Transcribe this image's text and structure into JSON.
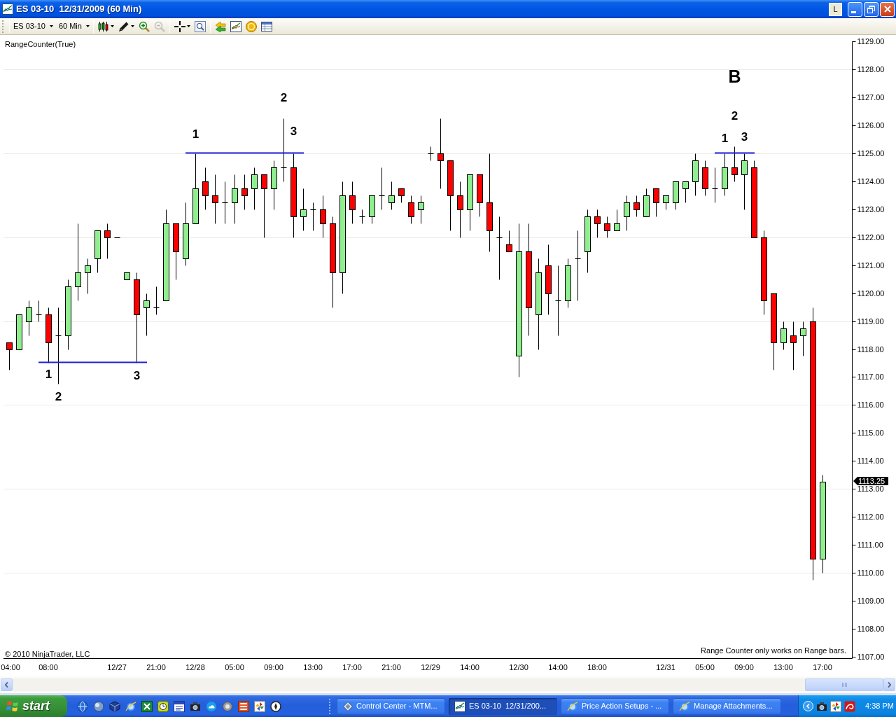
{
  "window": {
    "title": "ES 03-10  12/31/2009 (60 Min)",
    "corner_button": "L"
  },
  "toolbar": {
    "instrument": "ES 03-10",
    "interval": "60 Min",
    "tool_groups": [
      [
        {
          "kind": "bar_style",
          "disabled": false
        },
        {
          "kind": "draw",
          "disabled": false
        },
        {
          "kind": "zoom_in",
          "disabled": false
        },
        {
          "kind": "zoom_out",
          "disabled": true
        }
      ],
      [
        {
          "kind": "crosshair",
          "disabled": false
        },
        {
          "kind": "zoom_box",
          "disabled": false
        }
      ],
      [
        {
          "kind": "data_series",
          "disabled": false
        },
        {
          "kind": "indicators",
          "disabled": false
        },
        {
          "kind": "strategies",
          "disabled": false
        },
        {
          "kind": "properties",
          "disabled": false
        }
      ]
    ]
  },
  "chart": {
    "indicator_label": "RangeCounter(True)",
    "setup_labels": [
      {
        "kind": "letter",
        "text": "B"
      },
      {
        "kind": "count",
        "text": "2"
      },
      {
        "kind": "count",
        "text": "2"
      },
      {
        "kind": "count",
        "text": "1"
      },
      {
        "kind": "count",
        "text": "3"
      },
      {
        "kind": "count",
        "text": "1"
      },
      {
        "kind": "count",
        "text": "3"
      },
      {
        "kind": "count",
        "text": "1"
      },
      {
        "kind": "count",
        "text": "3"
      },
      {
        "kind": "count",
        "text": "2"
      }
    ],
    "last_price": "1113.25",
    "chart_data": {
      "type": "candlestick",
      "ylim": [
        1107,
        1129
      ],
      "grid": true,
      "categories": [
        "04:00",
        null,
        null,
        null,
        "08:00",
        null,
        null,
        null,
        null,
        null,
        null,
        "12/27",
        null,
        null,
        null,
        "21:00",
        null,
        null,
        null,
        "12/28",
        null,
        null,
        null,
        "05:00",
        null,
        null,
        null,
        "09:00",
        null,
        null,
        null,
        "13:00",
        null,
        null,
        null,
        "17:00",
        null,
        null,
        null,
        "21:00",
        null,
        null,
        null,
        "12/29",
        null,
        null,
        null,
        "14:00",
        null,
        null,
        null,
        null,
        "12/30",
        null,
        null,
        null,
        "14:00",
        null,
        null,
        null,
        "18:00",
        null,
        null,
        null,
        null,
        null,
        null,
        "12/31",
        null,
        null,
        null,
        "05:00",
        null,
        null,
        null,
        "09:00",
        null,
        null,
        null,
        "13:00",
        null,
        null,
        null,
        "17:00"
      ],
      "ohlc": [
        [
          1118.25,
          1118.25,
          1117.25,
          1118.0
        ],
        [
          1118.0,
          1119.25,
          1118.0,
          1119.25
        ],
        [
          1119.0,
          1119.75,
          1118.5,
          1119.5
        ],
        [
          1119.25,
          1119.75,
          1119.0,
          1119.25
        ],
        [
          1119.25,
          1119.5,
          1117.5,
          1118.25
        ],
        [
          1118.5,
          1119.5,
          1116.75,
          1118.5
        ],
        [
          1118.5,
          1120.5,
          1118.0,
          1120.25
        ],
        [
          1120.25,
          1122.5,
          1119.75,
          1120.75
        ],
        [
          1120.75,
          1121.25,
          1120.0,
          1121.0
        ],
        [
          1121.25,
          1122.25,
          1120.75,
          1122.25
        ],
        [
          1122.25,
          1122.5,
          1121.25,
          1122.0
        ],
        [
          1122.0,
          1122.0,
          1122.0,
          1122.0
        ],
        [
          1120.5,
          1120.75,
          1120.5,
          1120.75
        ],
        [
          1120.5,
          1120.75,
          1117.5,
          1119.25
        ],
        [
          1119.5,
          1120.0,
          1118.5,
          1119.75
        ],
        [
          1119.5,
          1120.25,
          1119.25,
          1119.5
        ],
        [
          1119.75,
          1123.0,
          1119.75,
          1122.5
        ],
        [
          1122.5,
          1122.5,
          1120.5,
          1121.5
        ],
        [
          1121.25,
          1123.25,
          1121.0,
          1122.5
        ],
        [
          1122.5,
          1125.0,
          1122.5,
          1123.75
        ],
        [
          1124.0,
          1124.5,
          1123.0,
          1123.5
        ],
        [
          1123.5,
          1124.25,
          1122.5,
          1123.25
        ],
        [
          1123.25,
          1124.0,
          1122.5,
          1123.25
        ],
        [
          1123.25,
          1124.25,
          1122.5,
          1123.75
        ],
        [
          1123.75,
          1124.25,
          1123.0,
          1123.5
        ],
        [
          1123.75,
          1124.5,
          1123.0,
          1124.25
        ],
        [
          1124.25,
          1124.25,
          1122.0,
          1123.75
        ],
        [
          1123.75,
          1124.75,
          1123.0,
          1124.5
        ],
        [
          1124.5,
          1126.25,
          1124.0,
          1124.5
        ],
        [
          1124.5,
          1125.0,
          1122.0,
          1122.75
        ],
        [
          1122.75,
          1123.75,
          1122.25,
          1123.0
        ],
        [
          1123.0,
          1123.25,
          1122.25,
          1123.0
        ],
        [
          1123.0,
          1123.5,
          1122.0,
          1122.5
        ],
        [
          1122.5,
          1122.75,
          1119.5,
          1120.75
        ],
        [
          1120.75,
          1124.0,
          1120.0,
          1123.5
        ],
        [
          1123.5,
          1124.0,
          1122.5,
          1123.0
        ],
        [
          1122.75,
          1123.0,
          1122.5,
          1122.75
        ],
        [
          1122.75,
          1123.5,
          1122.5,
          1123.5
        ],
        [
          1123.5,
          1124.5,
          1123.0,
          1123.5
        ],
        [
          1123.25,
          1124.0,
          1123.0,
          1123.5
        ],
        [
          1123.75,
          1123.75,
          1123.25,
          1123.5
        ],
        [
          1123.25,
          1123.5,
          1122.5,
          1122.75
        ],
        [
          1123.0,
          1123.5,
          1122.5,
          1123.25
        ],
        [
          1125.0,
          1125.25,
          1124.75,
          1125.0
        ],
        [
          1125.0,
          1126.25,
          1123.75,
          1124.75
        ],
        [
          1124.75,
          1124.75,
          1122.25,
          1123.5
        ],
        [
          1123.5,
          1124.0,
          1122.0,
          1123.0
        ],
        [
          1123.0,
          1124.25,
          1122.25,
          1124.25
        ],
        [
          1124.25,
          1124.25,
          1122.75,
          1123.25
        ],
        [
          1123.25,
          1125.0,
          1121.5,
          1122.25
        ],
        [
          1122.0,
          1122.75,
          1120.5,
          1122.0
        ],
        [
          1121.75,
          1122.25,
          1121.5,
          1121.5
        ],
        [
          1117.75,
          1122.5,
          1117.0,
          1121.5
        ],
        [
          1121.5,
          1122.5,
          1118.5,
          1119.5
        ],
        [
          1119.25,
          1121.25,
          1118.0,
          1120.75
        ],
        [
          1121.0,
          1121.75,
          1119.25,
          1120.0
        ],
        [
          1119.75,
          1121.0,
          1118.5,
          1119.75
        ],
        [
          1119.75,
          1121.25,
          1119.5,
          1121.0
        ],
        [
          1121.25,
          1122.25,
          1119.75,
          1121.25
        ],
        [
          1121.5,
          1123.0,
          1120.75,
          1122.75
        ],
        [
          1122.75,
          1123.0,
          1122.0,
          1122.5
        ],
        [
          1122.5,
          1122.75,
          1122.0,
          1122.25
        ],
        [
          1122.25,
          1123.0,
          1122.25,
          1122.5
        ],
        [
          1122.75,
          1123.5,
          1122.25,
          1123.25
        ],
        [
          1123.25,
          1123.5,
          1122.75,
          1123.0
        ],
        [
          1122.75,
          1123.75,
          1122.75,
          1123.5
        ],
        [
          1123.75,
          1123.75,
          1122.75,
          1123.25
        ],
        [
          1123.25,
          1123.5,
          1123.0,
          1123.5
        ],
        [
          1123.25,
          1124.0,
          1123.0,
          1124.0
        ],
        [
          1123.75,
          1124.0,
          1123.25,
          1124.0
        ],
        [
          1124.0,
          1125.0,
          1123.5,
          1124.75
        ],
        [
          1124.5,
          1124.75,
          1123.5,
          1123.75
        ],
        [
          1123.75,
          1124.5,
          1123.25,
          1123.75
        ],
        [
          1123.75,
          1125.0,
          1123.5,
          1124.5
        ],
        [
          1124.5,
          1125.25,
          1124.0,
          1124.25
        ],
        [
          1124.25,
          1125.0,
          1123.0,
          1124.75
        ],
        [
          1124.5,
          1124.75,
          1122.0,
          1122.0
        ],
        [
          1122.0,
          1122.25,
          1119.25,
          1119.75
        ],
        [
          1120.0,
          1120.0,
          1117.25,
          1118.25
        ],
        [
          1118.25,
          1119.0,
          1118.0,
          1118.75
        ],
        [
          1118.5,
          1119.0,
          1117.25,
          1118.25
        ],
        [
          1118.5,
          1119.0,
          1117.75,
          1118.75
        ],
        [
          1119.0,
          1119.5,
          1109.75,
          1110.5
        ],
        [
          1110.5,
          1113.5,
          1110.0,
          1113.25
        ]
      ],
      "yticks": [
        {
          "value": 1129,
          "label": "1129.00"
        },
        {
          "value": 1128,
          "label": "1128.00"
        },
        {
          "value": 1127,
          "label": "1127.00"
        },
        {
          "value": 1126,
          "label": "1126.00"
        },
        {
          "value": 1125,
          "label": "1125.00"
        },
        {
          "value": 1124,
          "label": "1124.00"
        },
        {
          "value": 1123,
          "label": "1123.00"
        },
        {
          "value": 1122,
          "label": "1122.00"
        },
        {
          "value": 1121,
          "label": "1121.00"
        },
        {
          "value": 1120,
          "label": "1120.00"
        },
        {
          "value": 1119,
          "label": "1119.00"
        },
        {
          "value": 1118,
          "label": "1118.00"
        },
        {
          "value": 1117,
          "label": "1117.00"
        },
        {
          "value": 1116,
          "label": "1116.00"
        },
        {
          "value": 1115,
          "label": "1115.00"
        },
        {
          "value": 1114,
          "label": "1114.00"
        },
        {
          "value": 1113,
          "label": "1113.00"
        },
        {
          "value": 1112,
          "label": "1112.00"
        },
        {
          "value": 1111,
          "label": "1111.00"
        },
        {
          "value": 1110,
          "label": "1110.00"
        },
        {
          "value": 1109,
          "label": "1109.00"
        },
        {
          "value": 1108,
          "label": "1108.00"
        },
        {
          "value": 1107,
          "label": "1107.00"
        }
      ]
    },
    "copyright": "© 2010 NinjaTrader, LLC",
    "message": "Range Counter only works on Range bars."
  },
  "taskbar": {
    "start": "start",
    "tasks": [
      {
        "kind": "app",
        "label": "Control Center - MTM...",
        "selected": false
      },
      {
        "kind": "chart",
        "label": "ES 03-10  12/31/200...",
        "selected": true
      },
      {
        "kind": "browser",
        "label": "Price Action Setups - ...",
        "selected": false
      },
      {
        "kind": "browser",
        "label": "Manage Attachments...",
        "selected": false
      }
    ],
    "clock": "4:38 PM"
  }
}
